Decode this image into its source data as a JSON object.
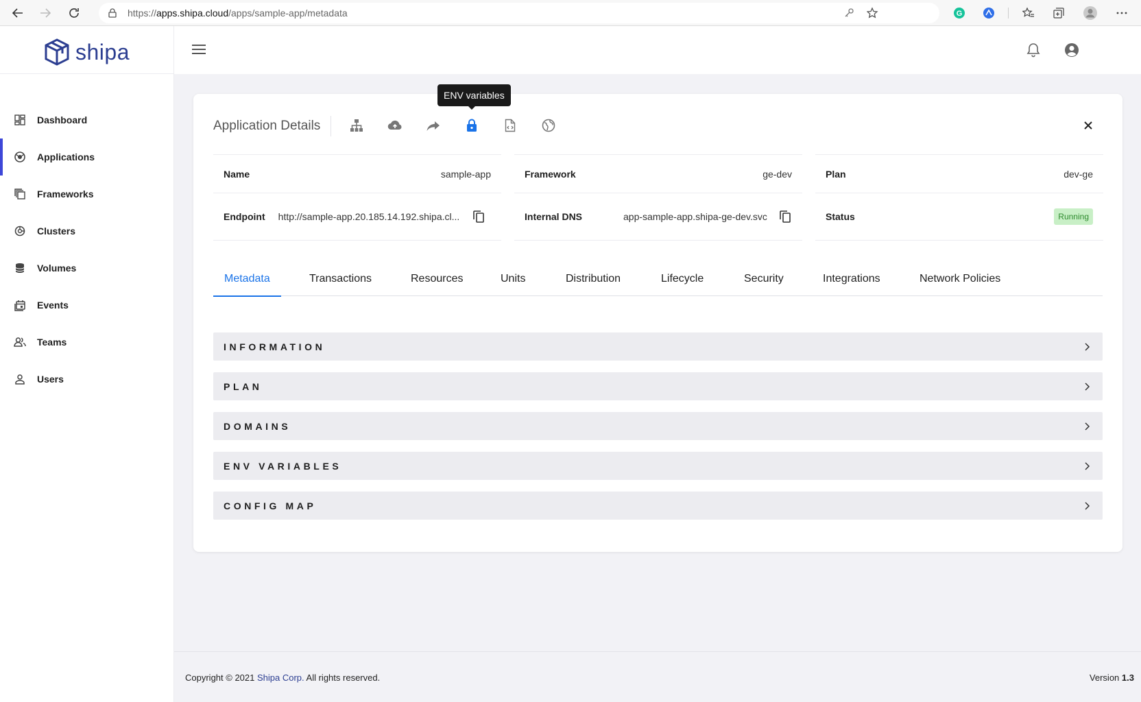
{
  "browser": {
    "url_scheme": "https://",
    "url_host": "apps.shipa.cloud",
    "url_path": "/apps/sample-app/metadata"
  },
  "brand": {
    "name": "shipa",
    "color": "#2c3e91"
  },
  "sidebar": {
    "items": [
      {
        "label": "Dashboard",
        "icon": "dashboard-icon",
        "active": false
      },
      {
        "label": "Applications",
        "icon": "applications-icon",
        "active": true
      },
      {
        "label": "Frameworks",
        "icon": "frameworks-icon",
        "active": false
      },
      {
        "label": "Clusters",
        "icon": "clusters-icon",
        "active": false
      },
      {
        "label": "Volumes",
        "icon": "volumes-icon",
        "active": false
      },
      {
        "label": "Events",
        "icon": "events-icon",
        "active": false
      },
      {
        "label": "Teams",
        "icon": "teams-icon",
        "active": false
      },
      {
        "label": "Users",
        "icon": "users-icon",
        "active": false
      }
    ],
    "active_color": "#3d47d8"
  },
  "card": {
    "title": "Application Details",
    "toolbar": [
      {
        "icon": "hierarchy-icon",
        "active": false
      },
      {
        "icon": "cloud-upload-icon",
        "active": false
      },
      {
        "icon": "forward-icon",
        "active": false
      },
      {
        "icon": "lock-icon",
        "active": true
      },
      {
        "icon": "code-file-icon",
        "active": false
      },
      {
        "icon": "globe-icon",
        "active": false
      }
    ],
    "tooltip": "ENV variables",
    "details": {
      "name_label": "Name",
      "name_value": "sample-app",
      "framework_label": "Framework",
      "framework_value": "ge-dev",
      "plan_label": "Plan",
      "plan_value": "dev-ge",
      "endpoint_label": "Endpoint",
      "endpoint_value": "http://sample-app.20.185.14.192.shipa.cl...",
      "dns_label": "Internal DNS",
      "dns_value": "app-sample-app.shipa-ge-dev.svc",
      "status_label": "Status",
      "status_value": "Running"
    },
    "tabs": [
      {
        "label": "Metadata",
        "active": true
      },
      {
        "label": "Transactions",
        "active": false
      },
      {
        "label": "Resources",
        "active": false
      },
      {
        "label": "Units",
        "active": false
      },
      {
        "label": "Distribution",
        "active": false
      },
      {
        "label": "Lifecycle",
        "active": false
      },
      {
        "label": "Security",
        "active": false
      },
      {
        "label": "Integrations",
        "active": false
      },
      {
        "label": "Network Policies",
        "active": false
      }
    ],
    "sections": [
      {
        "label": "INFORMATION"
      },
      {
        "label": "PLAN"
      },
      {
        "label": "DOMAINS"
      },
      {
        "label": "ENV VARIABLES"
      },
      {
        "label": "CONFIG MAP"
      }
    ]
  },
  "footer": {
    "copyright_prefix": "Copyright © 2021",
    "company": "Shipa Corp.",
    "copyright_suffix": "All rights reserved.",
    "version_label": "Version",
    "version_value": "1.3"
  },
  "colors": {
    "accent": "#1a73e8",
    "status_bg": "#c8efc6",
    "status_text": "#2e8b2e"
  }
}
